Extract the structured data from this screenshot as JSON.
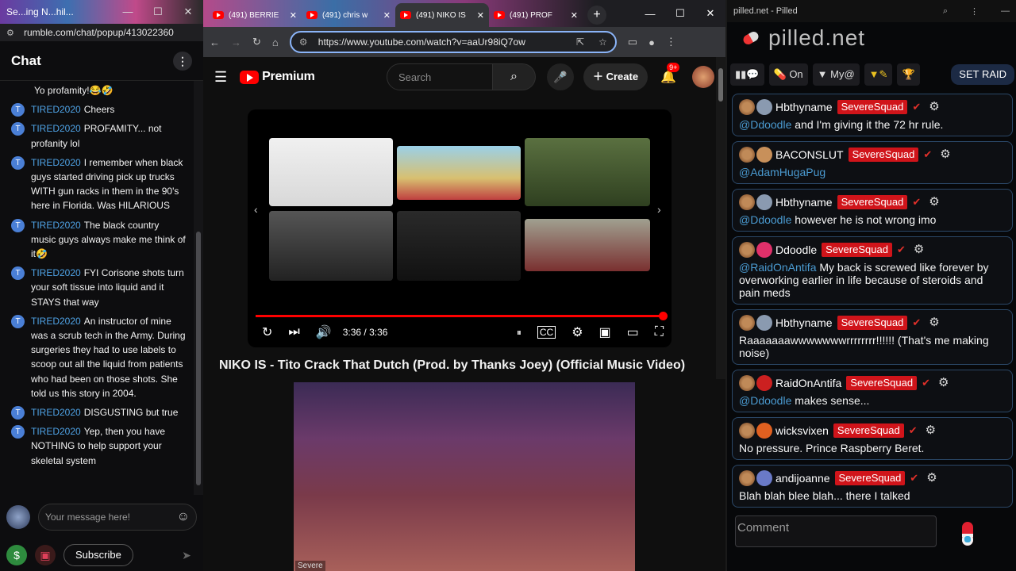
{
  "rumble": {
    "window_title": "Se...ing N...hil...",
    "url": "rumble.com/chat/popup/413022360",
    "chat_title": "Chat",
    "messages": [
      {
        "user": "",
        "text": "Yo profamity!😂🤣"
      },
      {
        "user": "TIRED2020",
        "text": "Cheers"
      },
      {
        "user": "TIRED2020",
        "text": "PROFAMITY... not profanity lol"
      },
      {
        "user": "TIRED2020",
        "text": "I remember when black guys started driving pick up trucks WITH gun racks in them in the 90's here in Florida. Was HILARIOUS"
      },
      {
        "user": "TIRED2020",
        "text": "The black country music guys always make me think of it🤣"
      },
      {
        "user": "TIRED2020",
        "text": "FYI Corisone shots turn your soft tissue into liquid and it STAYS that way"
      },
      {
        "user": "TIRED2020",
        "text": "An instructor of mine was a scrub tech in the Army. During surgeries they had to use labels to scoop out all the liquid from patients who had been on those shots. She told us this story in 2004."
      },
      {
        "user": "TIRED2020",
        "text": "DISGUSTING but true"
      },
      {
        "user": "TIRED2020",
        "text": "Yep, then you have NOTHING to help support your skeletal system"
      }
    ],
    "input_placeholder": "Your message here!",
    "subscribe_label": "Subscribe"
  },
  "youtube": {
    "tabs": [
      {
        "label": "(491) BERRIE"
      },
      {
        "label": "(491) chris w"
      },
      {
        "label": "(491) NIKO IS"
      },
      {
        "label": "(491) PROF"
      }
    ],
    "url": "https://www.youtube.com/watch?v=aaUr98iQ7ow",
    "logo_text": "Premium",
    "search_placeholder": "Search",
    "create_label": "Create",
    "notif_count": "9+",
    "time": "3:36 / 3:36",
    "progress": 1.0,
    "video_title": "NIKO IS - Tito Crack That Dutch (Prod. by Thanks Joey) (Official Music Video)",
    "webcam_label": "Severe"
  },
  "pilled": {
    "window_title": "pilled.net - Pilled",
    "brand": "pilled.net",
    "toolbar": {
      "on_label": "On",
      "my_label": "My@",
      "raid_label": "SET RAID"
    },
    "squad_label": "SevereSquad",
    "messages": [
      {
        "name": "Hbthyname",
        "avatar": "#8a9ab0",
        "mention": "@Ddoodle",
        "text": " and I'm giving it the 72 hr rule."
      },
      {
        "name": "BACONSLUT",
        "avatar": "#c8905a",
        "mention": "@AdamHugaPug",
        "text": ""
      },
      {
        "name": "Hbthyname",
        "avatar": "#8a9ab0",
        "mention": "@Ddoodle",
        "text": " however he is not wrong imo"
      },
      {
        "name": "Ddoodle",
        "avatar": "#e0306a",
        "mention": "@RaidOnAntifa",
        "text": " My back is screwed like forever by overworking earlier in life because of steroids and pain meds"
      },
      {
        "name": "Hbthyname",
        "avatar": "#8a9ab0",
        "mention": "",
        "text": "Raaaaaaawwwwwwwrrrrrrrr!!!!!! (That's me making noise)"
      },
      {
        "name": "RaidOnAntifa",
        "avatar": "#cc2020",
        "mention": "@Ddoodle",
        "text": " makes sense..."
      },
      {
        "name": "wicksvixen",
        "avatar": "#e06020",
        "mention": "",
        "text": "No pressure. Prince Raspberry Beret."
      },
      {
        "name": "andijoanne",
        "avatar": "#6a7ac8",
        "mention": "",
        "text": "Blah blah blee blah... there I talked"
      }
    ],
    "comment_placeholder": "Comment"
  }
}
